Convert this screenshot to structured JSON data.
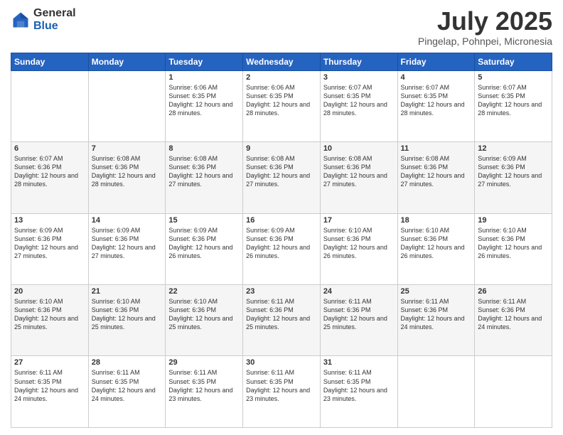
{
  "header": {
    "logo_general": "General",
    "logo_blue": "Blue",
    "month_title": "July 2025",
    "location": "Pingelap, Pohnpei, Micronesia"
  },
  "weekdays": [
    "Sunday",
    "Monday",
    "Tuesday",
    "Wednesday",
    "Thursday",
    "Friday",
    "Saturday"
  ],
  "weeks": [
    [
      {
        "day": "",
        "sunrise": "",
        "sunset": "",
        "daylight": ""
      },
      {
        "day": "",
        "sunrise": "",
        "sunset": "",
        "daylight": ""
      },
      {
        "day": "1",
        "sunrise": "Sunrise: 6:06 AM",
        "sunset": "Sunset: 6:35 PM",
        "daylight": "Daylight: 12 hours and 28 minutes."
      },
      {
        "day": "2",
        "sunrise": "Sunrise: 6:06 AM",
        "sunset": "Sunset: 6:35 PM",
        "daylight": "Daylight: 12 hours and 28 minutes."
      },
      {
        "day": "3",
        "sunrise": "Sunrise: 6:07 AM",
        "sunset": "Sunset: 6:35 PM",
        "daylight": "Daylight: 12 hours and 28 minutes."
      },
      {
        "day": "4",
        "sunrise": "Sunrise: 6:07 AM",
        "sunset": "Sunset: 6:35 PM",
        "daylight": "Daylight: 12 hours and 28 minutes."
      },
      {
        "day": "5",
        "sunrise": "Sunrise: 6:07 AM",
        "sunset": "Sunset: 6:35 PM",
        "daylight": "Daylight: 12 hours and 28 minutes."
      }
    ],
    [
      {
        "day": "6",
        "sunrise": "Sunrise: 6:07 AM",
        "sunset": "Sunset: 6:36 PM",
        "daylight": "Daylight: 12 hours and 28 minutes."
      },
      {
        "day": "7",
        "sunrise": "Sunrise: 6:08 AM",
        "sunset": "Sunset: 6:36 PM",
        "daylight": "Daylight: 12 hours and 28 minutes."
      },
      {
        "day": "8",
        "sunrise": "Sunrise: 6:08 AM",
        "sunset": "Sunset: 6:36 PM",
        "daylight": "Daylight: 12 hours and 27 minutes."
      },
      {
        "day": "9",
        "sunrise": "Sunrise: 6:08 AM",
        "sunset": "Sunset: 6:36 PM",
        "daylight": "Daylight: 12 hours and 27 minutes."
      },
      {
        "day": "10",
        "sunrise": "Sunrise: 6:08 AM",
        "sunset": "Sunset: 6:36 PM",
        "daylight": "Daylight: 12 hours and 27 minutes."
      },
      {
        "day": "11",
        "sunrise": "Sunrise: 6:08 AM",
        "sunset": "Sunset: 6:36 PM",
        "daylight": "Daylight: 12 hours and 27 minutes."
      },
      {
        "day": "12",
        "sunrise": "Sunrise: 6:09 AM",
        "sunset": "Sunset: 6:36 PM",
        "daylight": "Daylight: 12 hours and 27 minutes."
      }
    ],
    [
      {
        "day": "13",
        "sunrise": "Sunrise: 6:09 AM",
        "sunset": "Sunset: 6:36 PM",
        "daylight": "Daylight: 12 hours and 27 minutes."
      },
      {
        "day": "14",
        "sunrise": "Sunrise: 6:09 AM",
        "sunset": "Sunset: 6:36 PM",
        "daylight": "Daylight: 12 hours and 27 minutes."
      },
      {
        "day": "15",
        "sunrise": "Sunrise: 6:09 AM",
        "sunset": "Sunset: 6:36 PM",
        "daylight": "Daylight: 12 hours and 26 minutes."
      },
      {
        "day": "16",
        "sunrise": "Sunrise: 6:09 AM",
        "sunset": "Sunset: 6:36 PM",
        "daylight": "Daylight: 12 hours and 26 minutes."
      },
      {
        "day": "17",
        "sunrise": "Sunrise: 6:10 AM",
        "sunset": "Sunset: 6:36 PM",
        "daylight": "Daylight: 12 hours and 26 minutes."
      },
      {
        "day": "18",
        "sunrise": "Sunrise: 6:10 AM",
        "sunset": "Sunset: 6:36 PM",
        "daylight": "Daylight: 12 hours and 26 minutes."
      },
      {
        "day": "19",
        "sunrise": "Sunrise: 6:10 AM",
        "sunset": "Sunset: 6:36 PM",
        "daylight": "Daylight: 12 hours and 26 minutes."
      }
    ],
    [
      {
        "day": "20",
        "sunrise": "Sunrise: 6:10 AM",
        "sunset": "Sunset: 6:36 PM",
        "daylight": "Daylight: 12 hours and 25 minutes."
      },
      {
        "day": "21",
        "sunrise": "Sunrise: 6:10 AM",
        "sunset": "Sunset: 6:36 PM",
        "daylight": "Daylight: 12 hours and 25 minutes."
      },
      {
        "day": "22",
        "sunrise": "Sunrise: 6:10 AM",
        "sunset": "Sunset: 6:36 PM",
        "daylight": "Daylight: 12 hours and 25 minutes."
      },
      {
        "day": "23",
        "sunrise": "Sunrise: 6:11 AM",
        "sunset": "Sunset: 6:36 PM",
        "daylight": "Daylight: 12 hours and 25 minutes."
      },
      {
        "day": "24",
        "sunrise": "Sunrise: 6:11 AM",
        "sunset": "Sunset: 6:36 PM",
        "daylight": "Daylight: 12 hours and 25 minutes."
      },
      {
        "day": "25",
        "sunrise": "Sunrise: 6:11 AM",
        "sunset": "Sunset: 6:36 PM",
        "daylight": "Daylight: 12 hours and 24 minutes."
      },
      {
        "day": "26",
        "sunrise": "Sunrise: 6:11 AM",
        "sunset": "Sunset: 6:36 PM",
        "daylight": "Daylight: 12 hours and 24 minutes."
      }
    ],
    [
      {
        "day": "27",
        "sunrise": "Sunrise: 6:11 AM",
        "sunset": "Sunset: 6:35 PM",
        "daylight": "Daylight: 12 hours and 24 minutes."
      },
      {
        "day": "28",
        "sunrise": "Sunrise: 6:11 AM",
        "sunset": "Sunset: 6:35 PM",
        "daylight": "Daylight: 12 hours and 24 minutes."
      },
      {
        "day": "29",
        "sunrise": "Sunrise: 6:11 AM",
        "sunset": "Sunset: 6:35 PM",
        "daylight": "Daylight: 12 hours and 23 minutes."
      },
      {
        "day": "30",
        "sunrise": "Sunrise: 6:11 AM",
        "sunset": "Sunset: 6:35 PM",
        "daylight": "Daylight: 12 hours and 23 minutes."
      },
      {
        "day": "31",
        "sunrise": "Sunrise: 6:11 AM",
        "sunset": "Sunset: 6:35 PM",
        "daylight": "Daylight: 12 hours and 23 minutes."
      },
      {
        "day": "",
        "sunrise": "",
        "sunset": "",
        "daylight": ""
      },
      {
        "day": "",
        "sunrise": "",
        "sunset": "",
        "daylight": ""
      }
    ]
  ]
}
